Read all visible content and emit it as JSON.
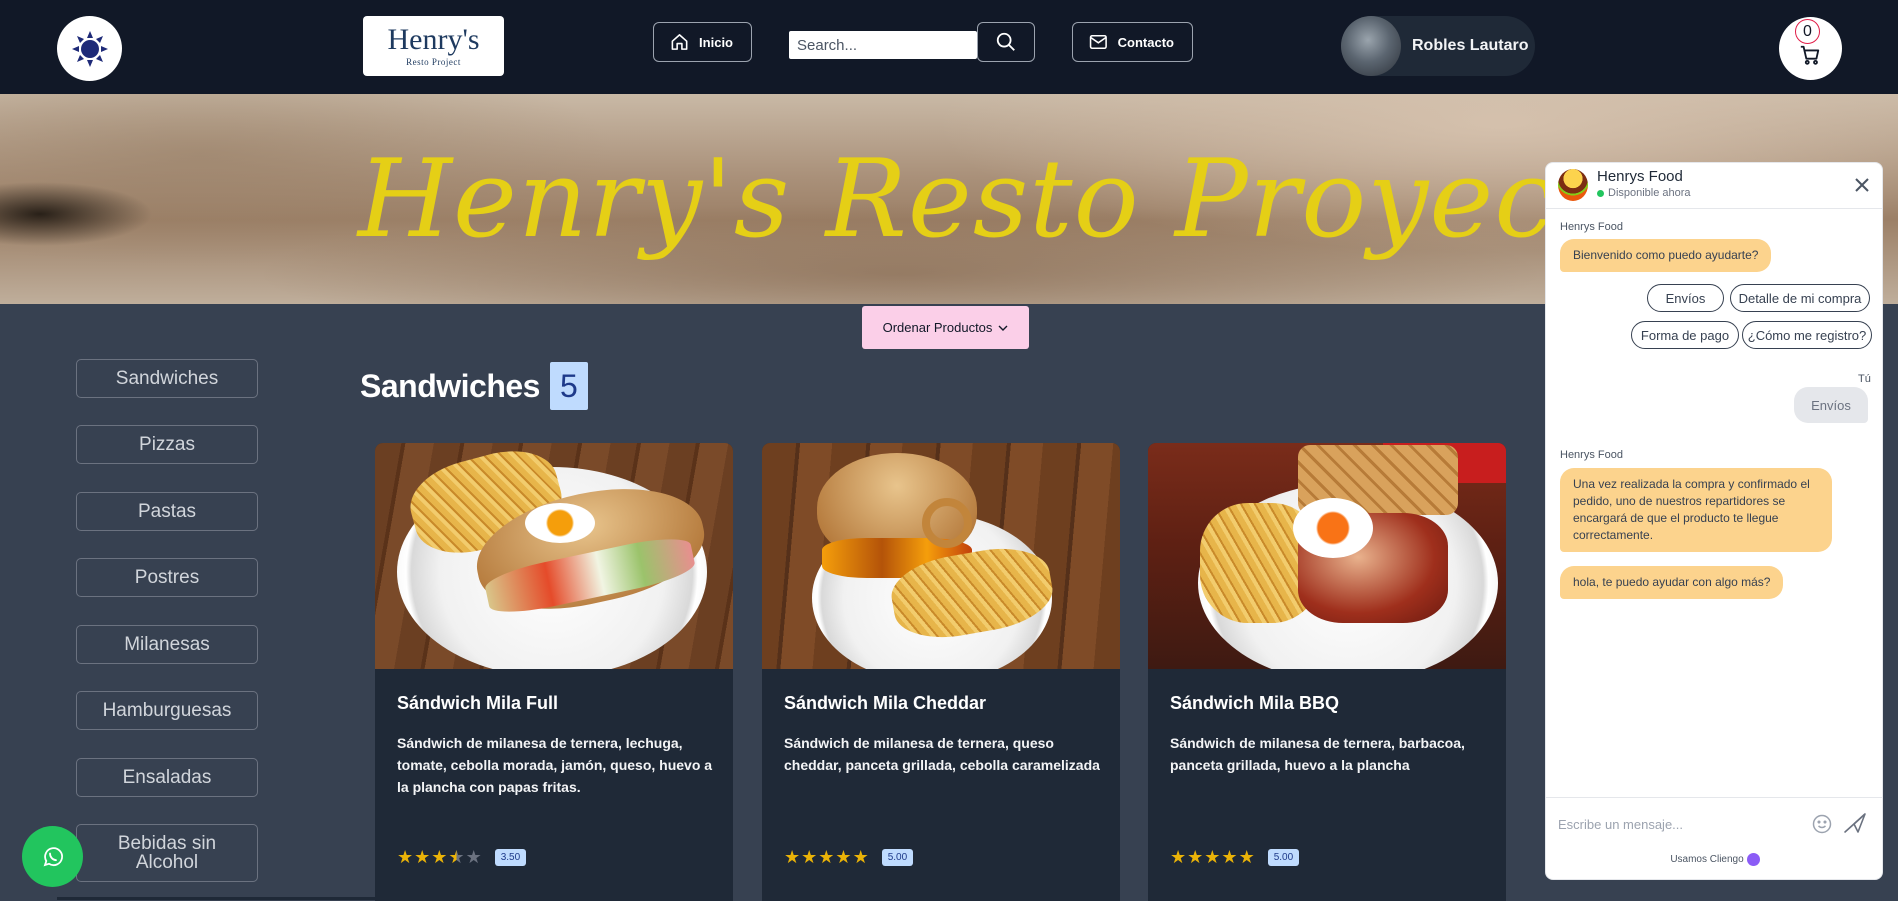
{
  "navbar": {
    "logo_title": "Henry's",
    "logo_subtitle": "Resto Project",
    "home_label": "Inicio",
    "search_placeholder": "Search...",
    "contact_label": "Contacto",
    "user_name": "Robles Lautaro",
    "cart_count": "0"
  },
  "hero": {
    "title": "Henry's Resto Proyect"
  },
  "order_button": "Ordenar Productos",
  "categories": [
    "Sandwiches",
    "Pizzas",
    "Pastas",
    "Postres",
    "Milanesas",
    "Hamburguesas",
    "Ensaladas",
    "Bebidas sin Alcohol"
  ],
  "section": {
    "title": "Sandwiches",
    "count": "5"
  },
  "products": [
    {
      "title": "Sándwich Mila Full",
      "description": "Sándwich de milanesa de ternera, lechuga, tomate, cebolla morada, jamón, queso, huevo a la plancha con papas fritas.",
      "rating": 3.5,
      "rating_label": "3.50"
    },
    {
      "title": "Sándwich Mila Cheddar",
      "description": "Sándwich de milanesa de ternera, queso cheddar, panceta grillada, cebolla caramelizada",
      "rating": 5,
      "rating_label": "5.00"
    },
    {
      "title": "Sándwich Mila BBQ",
      "description": "Sándwich de milanesa de ternera, barbacoa, panceta grillada, huevo a la plancha",
      "rating": 5,
      "rating_label": "5.00"
    }
  ],
  "chat": {
    "name": "Henrys Food",
    "status": "Disponible ahora",
    "bot_label": "Henrys Food",
    "welcome": "Bienvenido como puedo ayudarte?",
    "options": [
      "Envíos",
      "Detalle de mi compra",
      "Forma de pago",
      "¿Cómo me registro?"
    ],
    "user_label": "Tú",
    "user_message": "Envíos",
    "bot_label_2": "Henrys Food",
    "reply": "Una vez realizada la compra y confirmado el pedido, uno de nuestros repartidores se encargará de que el producto te llegue correctamente.",
    "followup": "hola, te puedo ayudar con algo más?",
    "input_placeholder": "Escribe un mensaje...",
    "footer": "Usamos Cliengo"
  },
  "colors": {
    "navbar_bg": "#111827",
    "page_bg": "#374151",
    "card_bg": "#1f2937",
    "hero_title": "#e5cf16",
    "order_button_bg": "#fbcfe8",
    "badge_bg": "#bfdbfe",
    "star": "#eab308",
    "chat_bot_bubble": "#fcd38d",
    "whatsapp": "#22c55e"
  },
  "icons": {
    "theme": "sun-icon",
    "home": "home-icon",
    "search": "search-icon",
    "contact": "envelope-icon",
    "cart": "cart-icon",
    "whatsapp": "whatsapp-icon",
    "close": "close-icon",
    "emoji": "emoji-icon",
    "send": "send-icon"
  }
}
